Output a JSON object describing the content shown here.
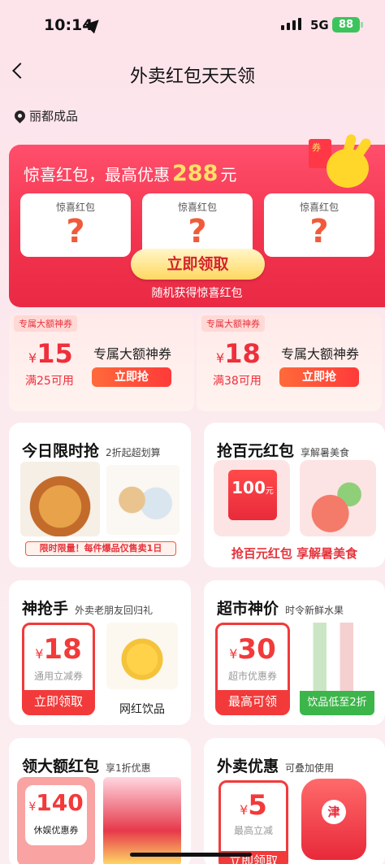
{
  "status_bar": {
    "time": "10:14",
    "network": "5G",
    "battery": "88"
  },
  "nav": {
    "title": "外卖红包天天领"
  },
  "location": {
    "text": "丽都成品"
  },
  "hero": {
    "headline_prefix": "惊喜红包，最高优惠",
    "headline_amount": "288",
    "headline_unit": "元",
    "cards": [
      {
        "label": "惊喜红包",
        "mark": "?"
      },
      {
        "label": "惊喜红包",
        "mark": "?"
      },
      {
        "label": "惊喜红包",
        "mark": "?"
      }
    ],
    "button": "立即领取",
    "subtext": "随机获得惊喜红包"
  },
  "coupons": [
    {
      "tag": "专属大额神券",
      "currency": "¥",
      "amount": "15",
      "min": "满25可用",
      "name": "专属大额神券",
      "button": "立即抢"
    },
    {
      "tag": "专属大额神券",
      "currency": "¥",
      "amount": "18",
      "min": "满38可用",
      "name": "专属大额神券",
      "button": "立即抢"
    }
  ],
  "flash": {
    "title": "今日限时抢",
    "subtitle": "2折起超划算",
    "banner": "限时限量！每件爆品仅售卖1日"
  },
  "hundred": {
    "title": "抢百元红包",
    "subtitle": "享解暑美食",
    "tile_value": "100",
    "tile_unit": "元",
    "footer": "抢百元红包 享解暑美食"
  },
  "shenqiang": {
    "title": "神抢手",
    "subtitle": "外卖老朋友回归礼",
    "currency": "¥",
    "amount": "18",
    "label": "通用立减券",
    "button": "立即领取",
    "item": "网红饮品"
  },
  "supermarket": {
    "title": "超市神价",
    "subtitle": "时令新鲜水果",
    "currency": "¥",
    "amount": "30",
    "label": "超市优惠券",
    "button": "最高可领",
    "tag": "饮品低至2折"
  },
  "big_red": {
    "title": "领大额红包",
    "subtitle": "享1折优惠",
    "currency": "¥",
    "amount": "140",
    "label": "休娱优惠券"
  },
  "waimai": {
    "title": "外卖优惠",
    "subtitle": "可叠加使用",
    "currency": "¥",
    "amount": "5",
    "label": "最高立减",
    "button": "立即领取",
    "cup_mark": "津"
  },
  "colors": {
    "primary_red": "#f23a3a",
    "accent_yellow": "#ffe066",
    "green_tag": "#3cb64a"
  }
}
